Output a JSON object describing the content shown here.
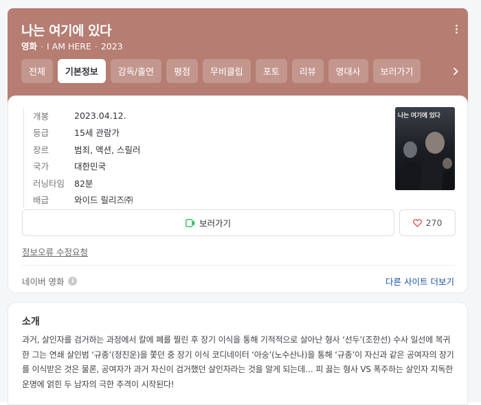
{
  "header": {
    "title": "나는 여기에 있다",
    "category": "영화",
    "original_title": "I AM HERE",
    "year": "2023",
    "more_icon": "more-vertical-icon",
    "background_color": "#b67d72"
  },
  "tabs": [
    {
      "label": "전체",
      "active": false
    },
    {
      "label": "기본정보",
      "active": true
    },
    {
      "label": "감독/출연",
      "active": false
    },
    {
      "label": "평점",
      "active": false
    },
    {
      "label": "무비클립",
      "active": false
    },
    {
      "label": "포토",
      "active": false
    },
    {
      "label": "리뷰",
      "active": false
    },
    {
      "label": "명대사",
      "active": false
    },
    {
      "label": "보러가기",
      "active": false
    }
  ],
  "info": [
    {
      "key": "개봉",
      "value": "2023.04.12."
    },
    {
      "key": "등급",
      "value": "15세 관람가"
    },
    {
      "key": "장르",
      "value": "범죄, 액션, 스릴러"
    },
    {
      "key": "국가",
      "value": "대한민국"
    },
    {
      "key": "러닝타임",
      "value": "82분"
    },
    {
      "key": "배급",
      "value": "와이드 릴리즈㈜"
    }
  ],
  "poster": {
    "title_text": "나는 여기에 있다"
  },
  "actions": {
    "watch_label": "보러가기",
    "like_count": "270"
  },
  "links": {
    "report": "정보오류 수정요청",
    "source": "네이버 영화",
    "other_sites": "다른 사이트 더보기"
  },
  "synopsis": {
    "title": "소개",
    "text": "과거, 살인자를 검거하는 과정에서 칼에 폐를 찔린 후 장기 이식을 통해 기적적으로 살아난 형사 ‘선두’(조한선) 수사 일선에 복귀한 그는 연쇄 살인범 ‘규종’(정진운)을 쫓던 중 장기 이식 코디네이터 ‘아숭’(노수산나)을 통해 ‘규종’이 자신과 같은 공여자의 장기를 이식받은 것은 물론, 공여자가 과거 자신이 검거했던 살인자라는 것을 알게 되는데… 피 끓는 형사 VS 폭주하는 살인자 지독한 운명에 얽힌 두 남자의 극한 추격이 시작된다!"
  }
}
